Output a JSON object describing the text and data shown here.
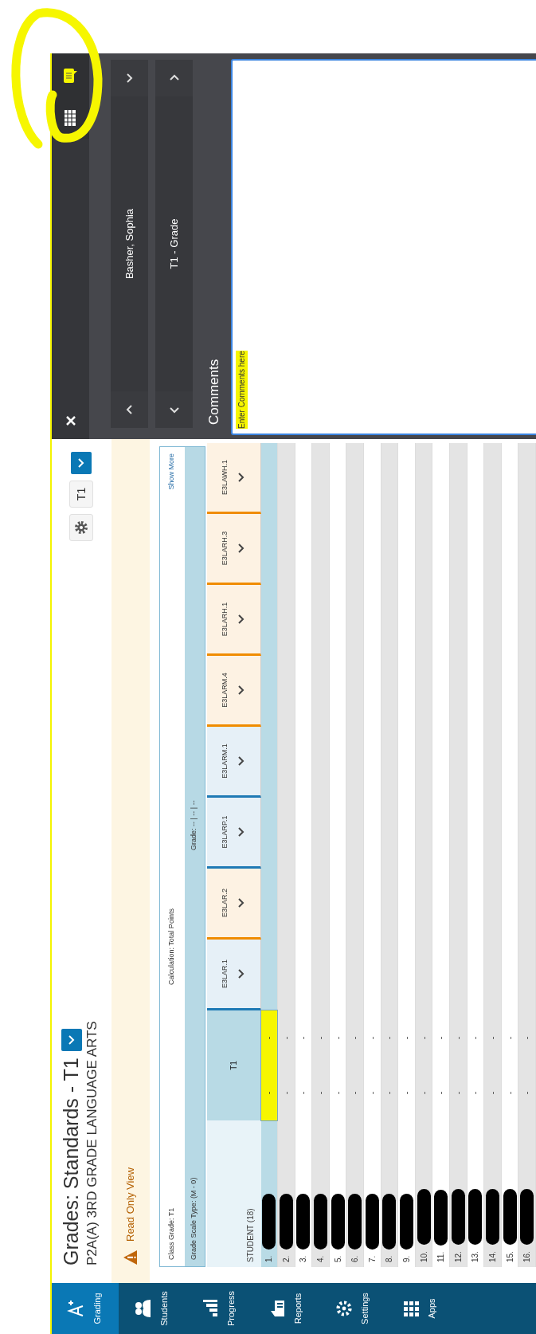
{
  "nav": [
    {
      "label": "Grading",
      "kind": "grade",
      "selected": true
    },
    {
      "label": "Students",
      "kind": "students",
      "selected": false
    },
    {
      "label": "Progress",
      "kind": "progress",
      "selected": false
    },
    {
      "label": "Reports",
      "kind": "reports",
      "selected": false
    },
    {
      "label": "Settings",
      "kind": "settings",
      "selected": false
    },
    {
      "label": "Apps",
      "kind": "apps",
      "selected": false
    }
  ],
  "header": {
    "title": "Grades: Standards - T1",
    "subtitle": "P2A(A) 3RD GRADE LANGUAGE ARTS",
    "term": "T1"
  },
  "notice": {
    "text": "Read Only View"
  },
  "summary": {
    "class_grade": "Class Grade: T1",
    "calculation": "Calculation: Total Points",
    "show_more": "Show More",
    "scale_type": "Grade Scale Type: (M - 0)",
    "grade": "Grade: -- | -- | --"
  },
  "table": {
    "student_header": "STUDENT (18)",
    "term_header": "T1",
    "standards": [
      {
        "label": "E3LAR.1",
        "color": "#1f7ab5"
      },
      {
        "label": "E3LAR.2",
        "color": "#f08c00"
      },
      {
        "label": "E3LARP.1",
        "color": "#1f7ab5"
      },
      {
        "label": "E3LARM.1",
        "color": "#1f7ab5"
      },
      {
        "label": "E3LARM.4",
        "color": "#f08c00"
      },
      {
        "label": "E3LARH.1",
        "color": "#f08c00"
      },
      {
        "label": "E3LARH.3",
        "color": "#f08c00"
      },
      {
        "label": "E3LAWH.1",
        "color": "#f08c00"
      }
    ],
    "rows": [
      {
        "number": "1.",
        "values": [
          "-",
          "-"
        ],
        "selected": true,
        "highlighted": true,
        "redacted": true
      },
      {
        "number": "2.",
        "values": [
          "-",
          "-"
        ],
        "selected": false,
        "highlighted": false,
        "redacted": true
      },
      {
        "number": "3.",
        "values": [
          "-",
          "-"
        ],
        "selected": false,
        "highlighted": false,
        "redacted": true
      },
      {
        "number": "4.",
        "values": [
          "-",
          "-"
        ],
        "selected": false,
        "highlighted": false,
        "redacted": true
      },
      {
        "number": "5.",
        "values": [
          "-",
          "-"
        ],
        "selected": false,
        "highlighted": false,
        "redacted": true
      },
      {
        "number": "6.",
        "values": [
          "-",
          "-"
        ],
        "selected": false,
        "highlighted": false,
        "redacted": true
      },
      {
        "number": "7.",
        "values": [
          "-",
          "-"
        ],
        "selected": false,
        "highlighted": false,
        "redacted": true
      },
      {
        "number": "8.",
        "values": [
          "-",
          "-"
        ],
        "selected": false,
        "highlighted": false,
        "redacted": true
      },
      {
        "number": "9.",
        "values": [
          "-",
          "-"
        ],
        "selected": false,
        "highlighted": false,
        "redacted": true
      },
      {
        "number": "10.",
        "values": [
          "-",
          "-"
        ],
        "selected": false,
        "highlighted": false,
        "redacted": true
      },
      {
        "number": "11.",
        "values": [
          "-",
          "-"
        ],
        "selected": false,
        "highlighted": false,
        "redacted": true
      },
      {
        "number": "12.",
        "values": [
          "-",
          "-"
        ],
        "selected": false,
        "highlighted": false,
        "redacted": true
      },
      {
        "number": "13.",
        "values": [
          "-",
          "-"
        ],
        "selected": false,
        "highlighted": false,
        "redacted": true
      },
      {
        "number": "14.",
        "values": [
          "-",
          "-"
        ],
        "selected": false,
        "highlighted": false,
        "redacted": true
      },
      {
        "number": "15.",
        "values": [
          "-",
          "-"
        ],
        "selected": false,
        "highlighted": false,
        "redacted": true
      },
      {
        "number": "16.",
        "values": [
          "-",
          "-"
        ],
        "selected": false,
        "highlighted": false,
        "redacted": true
      }
    ]
  },
  "panel": {
    "student": "Basher, Sophia",
    "view": "T1 - Grade",
    "comments_label": "Comments",
    "comments_value": "Enter Comments here",
    "comments_highlighted": true,
    "tools": [
      {
        "kind": "comment",
        "selected": true
      },
      {
        "kind": "grid",
        "selected": false
      }
    ]
  },
  "annotations": [
    {
      "kind": "circle"
    }
  ]
}
